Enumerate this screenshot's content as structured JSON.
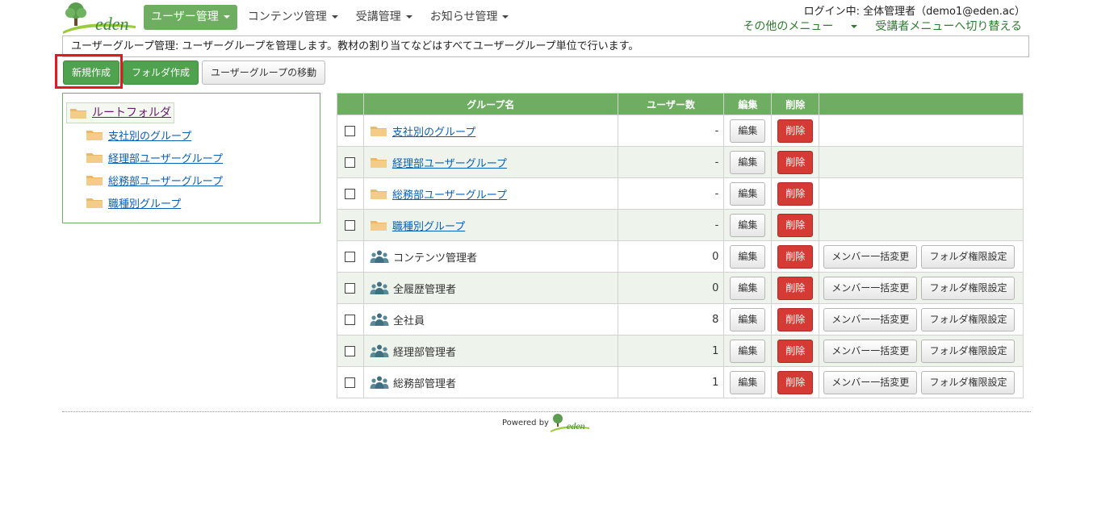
{
  "app": {
    "logo_text": "eden"
  },
  "nav": {
    "items": [
      {
        "label": "ユーザー管理",
        "active": true
      },
      {
        "label": "コンテンツ管理",
        "active": false
      },
      {
        "label": "受講管理",
        "active": false
      },
      {
        "label": "お知らせ管理",
        "active": false
      }
    ]
  },
  "header": {
    "login_info": "ログイン中: 全体管理者（demo1@eden.ac）",
    "other_menu": "その他のメニュー",
    "switch_learner": "受講者メニューへ切り替える"
  },
  "description": "ユーザーグループ管理: ユーザーグループを管理します。教材の割り当てなどはすべてユーザーグループ単位で行います。",
  "toolbar": {
    "new_label": "新規作成",
    "folder_label": "フォルダ作成",
    "move_label": "ユーザーグループの移動"
  },
  "tree": {
    "root_label": "ルートフォルダ",
    "items": [
      "支社別のグループ",
      "経理部ユーザーグループ",
      "総務部ユーザーグループ",
      "職種別グループ"
    ]
  },
  "table": {
    "headers": {
      "check": "",
      "name": "グループ名",
      "count": "ユーザー数",
      "edit": "編集",
      "delete": "削除",
      "extra": ""
    },
    "edit_label": "編集",
    "delete_label": "削除",
    "bulk_label": "メンバー一括変更",
    "perm_label": "フォルダ権限設定",
    "rows": [
      {
        "type": "folder",
        "name": "支社別のグループ",
        "count": "-"
      },
      {
        "type": "folder",
        "name": "経理部ユーザーグループ",
        "count": "-"
      },
      {
        "type": "folder",
        "name": "総務部ユーザーグループ",
        "count": "-"
      },
      {
        "type": "folder",
        "name": "職種別グループ",
        "count": "-"
      },
      {
        "type": "group",
        "name": "コンテンツ管理者",
        "count": "0"
      },
      {
        "type": "group",
        "name": "全履歴管理者",
        "count": "0"
      },
      {
        "type": "group",
        "name": "全社員",
        "count": "8"
      },
      {
        "type": "group",
        "name": "経理部管理者",
        "count": "1"
      },
      {
        "type": "group",
        "name": "総務部管理者",
        "count": "1"
      }
    ]
  },
  "footer": {
    "powered_by": "Powered by",
    "logo_text": "eden"
  },
  "colors": {
    "accent": "#6fad63",
    "danger": "#d53a34",
    "highlight": "#e11b1b",
    "link": "#0a5fb4"
  }
}
